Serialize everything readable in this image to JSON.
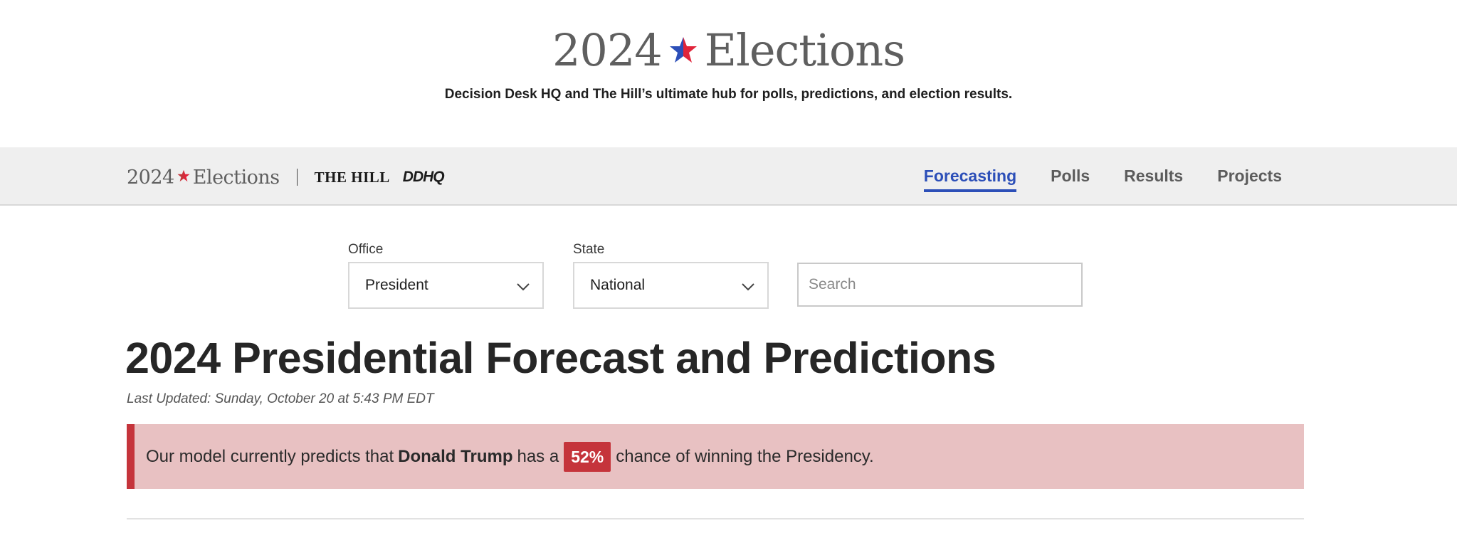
{
  "hero": {
    "title_year": "2024",
    "title_word": "Elections",
    "subtitle": "Decision Desk HQ and The Hill’s ultimate hub for polls, predictions, and election results."
  },
  "navbar": {
    "brand_year": "2024",
    "brand_word": "Elections",
    "partner1": "THE HILL",
    "partner2": "DDHQ",
    "links": [
      {
        "label": "Forecasting",
        "active": true
      },
      {
        "label": "Polls",
        "active": false
      },
      {
        "label": "Results",
        "active": false
      },
      {
        "label": "Projects",
        "active": false
      }
    ]
  },
  "filters": {
    "office": {
      "label": "Office",
      "value": "President"
    },
    "state": {
      "label": "State",
      "value": "National"
    },
    "search": {
      "placeholder": "Search"
    }
  },
  "main": {
    "title": "2024 Presidential Forecast and Predictions",
    "last_updated": "Last Updated: Sunday, October 20 at 5:43 PM EDT",
    "prediction": {
      "prefix": "Our model currently predicts that",
      "candidate": "Donald Trump",
      "middle": "has a",
      "chance": "52%",
      "suffix": "chance of winning the Presidency."
    }
  },
  "colors": {
    "accent_blue": "#2c4fb8",
    "republican_red": "#c5343b",
    "banner_bg": "#e8c1c2",
    "star_blue": "#2c4fb8",
    "star_red": "#e0243a"
  }
}
